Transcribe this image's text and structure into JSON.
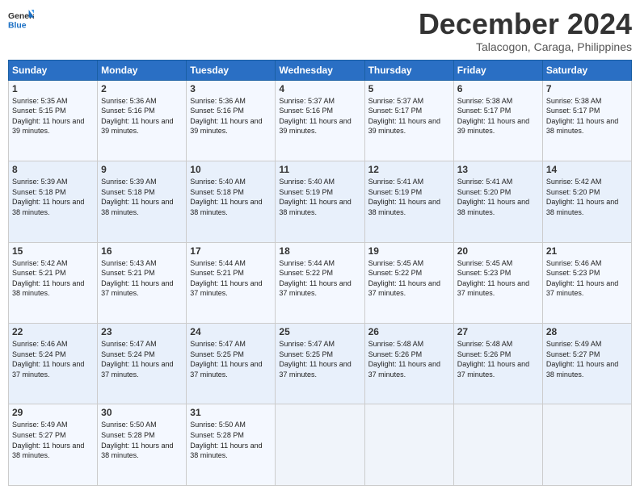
{
  "logo": {
    "line1": "General",
    "line2": "Blue"
  },
  "header": {
    "month": "December 2024",
    "location": "Talacogon, Caraga, Philippines"
  },
  "days_of_week": [
    "Sunday",
    "Monday",
    "Tuesday",
    "Wednesday",
    "Thursday",
    "Friday",
    "Saturday"
  ],
  "weeks": [
    [
      {
        "day": "1",
        "sunrise": "5:35 AM",
        "sunset": "5:15 PM",
        "daylight": "11 hours and 39 minutes."
      },
      {
        "day": "2",
        "sunrise": "5:36 AM",
        "sunset": "5:16 PM",
        "daylight": "11 hours and 39 minutes."
      },
      {
        "day": "3",
        "sunrise": "5:36 AM",
        "sunset": "5:16 PM",
        "daylight": "11 hours and 39 minutes."
      },
      {
        "day": "4",
        "sunrise": "5:37 AM",
        "sunset": "5:16 PM",
        "daylight": "11 hours and 39 minutes."
      },
      {
        "day": "5",
        "sunrise": "5:37 AM",
        "sunset": "5:17 PM",
        "daylight": "11 hours and 39 minutes."
      },
      {
        "day": "6",
        "sunrise": "5:38 AM",
        "sunset": "5:17 PM",
        "daylight": "11 hours and 39 minutes."
      },
      {
        "day": "7",
        "sunrise": "5:38 AM",
        "sunset": "5:17 PM",
        "daylight": "11 hours and 38 minutes."
      }
    ],
    [
      {
        "day": "8",
        "sunrise": "5:39 AM",
        "sunset": "5:18 PM",
        "daylight": "11 hours and 38 minutes."
      },
      {
        "day": "9",
        "sunrise": "5:39 AM",
        "sunset": "5:18 PM",
        "daylight": "11 hours and 38 minutes."
      },
      {
        "day": "10",
        "sunrise": "5:40 AM",
        "sunset": "5:18 PM",
        "daylight": "11 hours and 38 minutes."
      },
      {
        "day": "11",
        "sunrise": "5:40 AM",
        "sunset": "5:19 PM",
        "daylight": "11 hours and 38 minutes."
      },
      {
        "day": "12",
        "sunrise": "5:41 AM",
        "sunset": "5:19 PM",
        "daylight": "11 hours and 38 minutes."
      },
      {
        "day": "13",
        "sunrise": "5:41 AM",
        "sunset": "5:20 PM",
        "daylight": "11 hours and 38 minutes."
      },
      {
        "day": "14",
        "sunrise": "5:42 AM",
        "sunset": "5:20 PM",
        "daylight": "11 hours and 38 minutes."
      }
    ],
    [
      {
        "day": "15",
        "sunrise": "5:42 AM",
        "sunset": "5:21 PM",
        "daylight": "11 hours and 38 minutes."
      },
      {
        "day": "16",
        "sunrise": "5:43 AM",
        "sunset": "5:21 PM",
        "daylight": "11 hours and 37 minutes."
      },
      {
        "day": "17",
        "sunrise": "5:44 AM",
        "sunset": "5:21 PM",
        "daylight": "11 hours and 37 minutes."
      },
      {
        "day": "18",
        "sunrise": "5:44 AM",
        "sunset": "5:22 PM",
        "daylight": "11 hours and 37 minutes."
      },
      {
        "day": "19",
        "sunrise": "5:45 AM",
        "sunset": "5:22 PM",
        "daylight": "11 hours and 37 minutes."
      },
      {
        "day": "20",
        "sunrise": "5:45 AM",
        "sunset": "5:23 PM",
        "daylight": "11 hours and 37 minutes."
      },
      {
        "day": "21",
        "sunrise": "5:46 AM",
        "sunset": "5:23 PM",
        "daylight": "11 hours and 37 minutes."
      }
    ],
    [
      {
        "day": "22",
        "sunrise": "5:46 AM",
        "sunset": "5:24 PM",
        "daylight": "11 hours and 37 minutes."
      },
      {
        "day": "23",
        "sunrise": "5:47 AM",
        "sunset": "5:24 PM",
        "daylight": "11 hours and 37 minutes."
      },
      {
        "day": "24",
        "sunrise": "5:47 AM",
        "sunset": "5:25 PM",
        "daylight": "11 hours and 37 minutes."
      },
      {
        "day": "25",
        "sunrise": "5:47 AM",
        "sunset": "5:25 PM",
        "daylight": "11 hours and 37 minutes."
      },
      {
        "day": "26",
        "sunrise": "5:48 AM",
        "sunset": "5:26 PM",
        "daylight": "11 hours and 37 minutes."
      },
      {
        "day": "27",
        "sunrise": "5:48 AM",
        "sunset": "5:26 PM",
        "daylight": "11 hours and 37 minutes."
      },
      {
        "day": "28",
        "sunrise": "5:49 AM",
        "sunset": "5:27 PM",
        "daylight": "11 hours and 38 minutes."
      }
    ],
    [
      {
        "day": "29",
        "sunrise": "5:49 AM",
        "sunset": "5:27 PM",
        "daylight": "11 hours and 38 minutes."
      },
      {
        "day": "30",
        "sunrise": "5:50 AM",
        "sunset": "5:28 PM",
        "daylight": "11 hours and 38 minutes."
      },
      {
        "day": "31",
        "sunrise": "5:50 AM",
        "sunset": "5:28 PM",
        "daylight": "11 hours and 38 minutes."
      },
      null,
      null,
      null,
      null
    ]
  ]
}
